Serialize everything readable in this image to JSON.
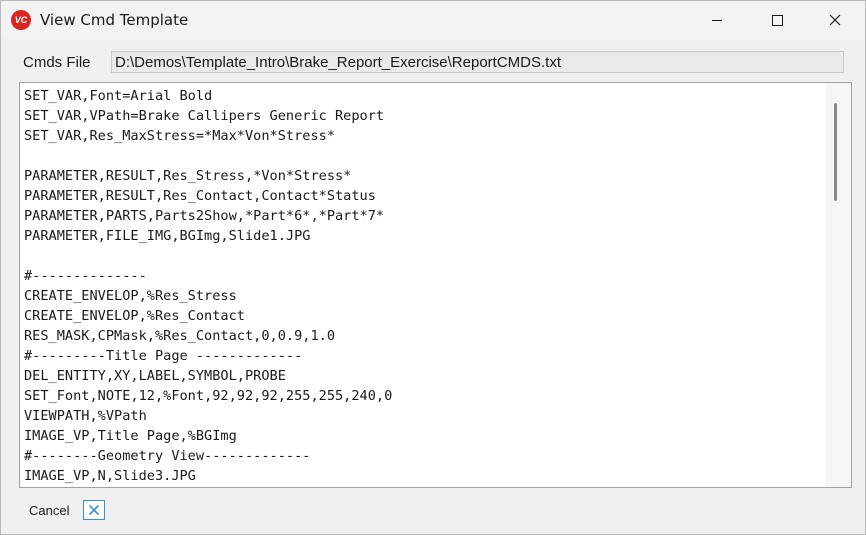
{
  "window": {
    "title": "View Cmd Template",
    "app_icon_text": "VC",
    "accent_color": "#d9241f"
  },
  "controls": {
    "minimize_icon": "minimize-icon",
    "maximize_icon": "maximize-icon",
    "close_icon": "close-icon"
  },
  "cmds_file": {
    "label": "Cmds File",
    "value": "D:\\Demos\\Template_Intro\\Brake_Report_Exercise\\ReportCMDS.txt"
  },
  "editor": {
    "lines": [
      "SET_VAR,Font=Arial Bold",
      "SET_VAR,VPath=Brake Callipers Generic Report",
      "SET_VAR,Res_MaxStress=*Max*Von*Stress*",
      "",
      "PARAMETER,RESULT,Res_Stress,*Von*Stress*",
      "PARAMETER,RESULT,Res_Contact,Contact*Status",
      "PARAMETER,PARTS,Parts2Show,*Part*6*,*Part*7*",
      "PARAMETER,FILE_IMG,BGImg,Slide1.JPG",
      "",
      "#--------------",
      "CREATE_ENVELOP,%Res_Stress",
      "CREATE_ENVELOP,%Res_Contact",
      "RES_MASK,CPMask,%Res_Contact,0,0.9,1.0",
      "#---------Title Page -------------",
      "DEL_ENTITY,XY,LABEL,SYMBOL,PROBE",
      "SET_Font,NOTE,12,%Font,92,92,92,255,255,240,0",
      "VIEWPATH,%VPath",
      "IMAGE_VP,Title Page,%BGImg",
      "#--------Geometry View-------------",
      "IMAGE_VP,N,Slide3.JPG"
    ]
  },
  "footer": {
    "cancel_label": "Cancel",
    "cancel_icon": "close-icon",
    "cancel_color": "#3c8fd6"
  }
}
